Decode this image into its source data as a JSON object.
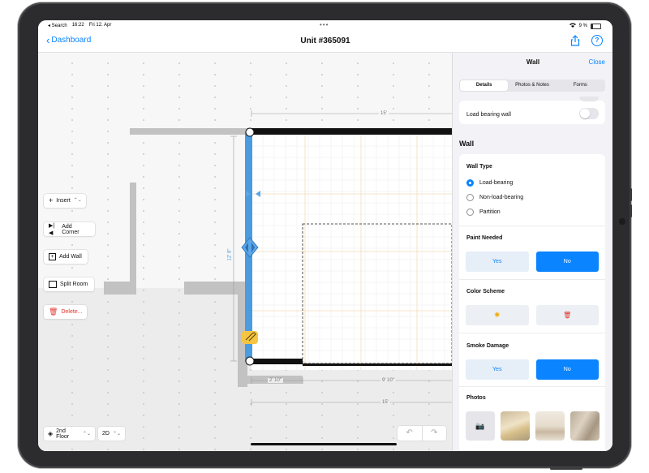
{
  "status_bar": {
    "back_app": "◂ Search",
    "time": "16:22",
    "date": "Fri 12. Apr",
    "battery": "9 %"
  },
  "nav": {
    "back_label": "Dashboard",
    "title": "Unit #365091"
  },
  "tools": {
    "insert": "Insert",
    "add_corner": "Add Corner",
    "add_wall": "Add Wall",
    "split_room": "Split Room",
    "delete": "Delete..."
  },
  "bottom": {
    "floor": "2nd Floor",
    "view_mode": "2D"
  },
  "dimensions": {
    "top": "15'",
    "left": "12' 8\"",
    "bottom_left": "2' 10\"",
    "bottom_mid": "9' 10\"",
    "bottom_total": "15'"
  },
  "colors": {
    "accent": "#0a84ff",
    "selected_wall": "#4a9be0",
    "danger": "#e0342b",
    "marker": "#f5c542"
  },
  "panel": {
    "title": "Wall",
    "close": "Close",
    "tabs": [
      {
        "label": "Details",
        "active": true
      },
      {
        "label": "Photos & Notes",
        "active": false
      },
      {
        "label": "Forms",
        "active": false
      }
    ],
    "load_bearing_label": "Load bearing wall",
    "load_bearing_on": false,
    "section_title": "Wall",
    "wall_type": {
      "label": "Wall Type",
      "options": [
        "Load-bearing",
        "Non-load-bearing",
        "Partition"
      ],
      "selected": "Load-bearing"
    },
    "paint_needed": {
      "label": "Paint Needed",
      "yes": "Yes",
      "no": "No",
      "selected": "No"
    },
    "color_scheme": {
      "label": "Color Scheme",
      "icons": [
        "sun-icon",
        "trash-icon"
      ]
    },
    "smoke_damage": {
      "label": "Smoke Damage",
      "yes": "Yes",
      "no": "No",
      "selected": "No"
    },
    "photos_label": "Photos"
  }
}
